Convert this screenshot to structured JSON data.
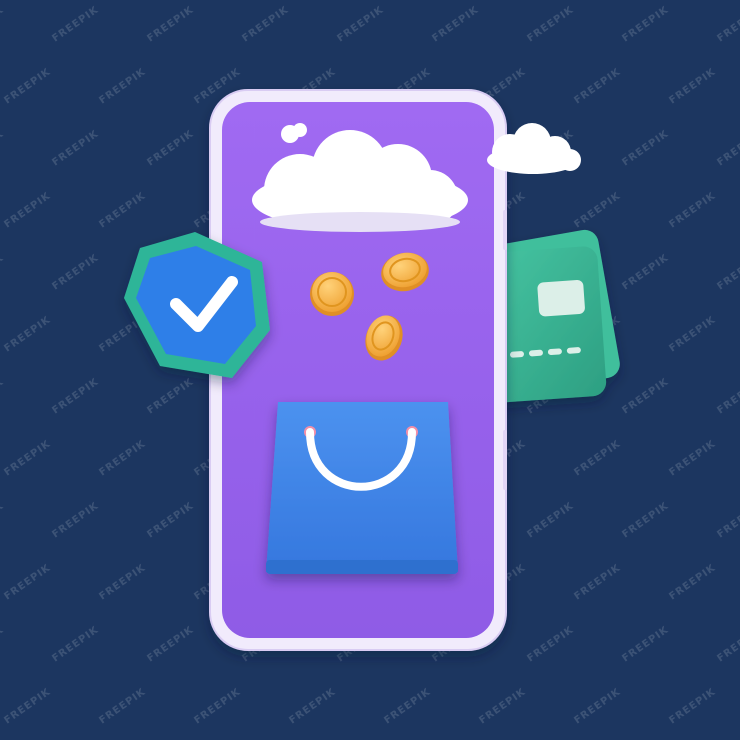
{
  "watermark": {
    "text": "FREEPIK"
  },
  "colors": {
    "background": "#1c3660",
    "phone_frame": "#efe8fb",
    "phone_screen": "#9a63ee",
    "shield_outer": "#2fb59a",
    "shield_inner": "#2f7de6",
    "check": "#ffffff",
    "coin": "#f5b449",
    "bag": "#3f86e8",
    "card": "#35b392",
    "card_chip": "#dcefe8",
    "cloud": "#ffffff"
  },
  "icons": {
    "shield": "shield-check-icon",
    "cloud": "cloud-icon",
    "coin": "coin-icon",
    "bag": "shopping-bag-icon",
    "card": "credit-card-icon"
  }
}
